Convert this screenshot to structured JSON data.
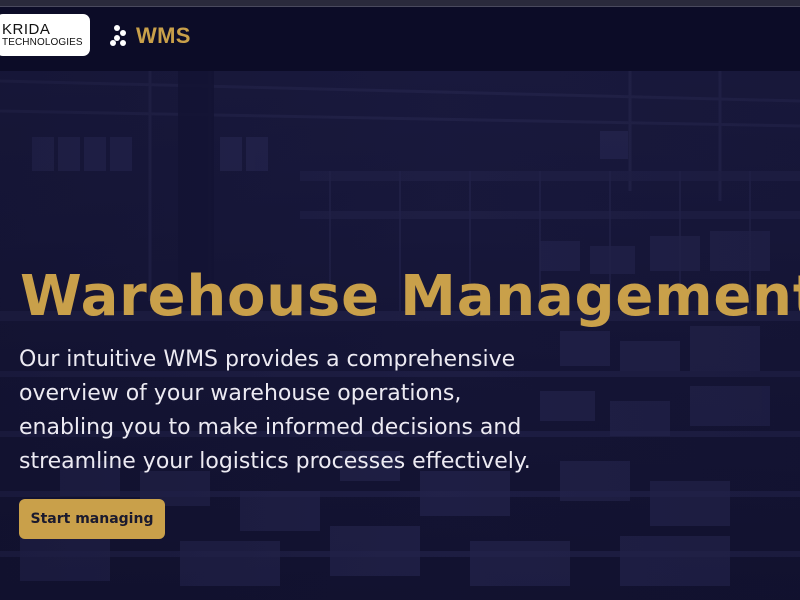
{
  "navbar": {
    "brand_line1": "KRIDA",
    "brand_line2": "TECHNOLOGIES",
    "product_name": "WMS"
  },
  "hero": {
    "title": "Warehouse Management System",
    "description": "Our intuitive WMS provides a comprehensive overview of your warehouse operations, enabling you to make informed decisions and streamline your logistics processes effectively.",
    "cta_label": "Start managing"
  },
  "colors": {
    "accent": "#c9a04a",
    "navbar_bg": "#0c0c27",
    "hero_overlay": "#1a1a40",
    "text": "#eceaf2"
  },
  "icons": [
    "dots-grid-icon"
  ]
}
